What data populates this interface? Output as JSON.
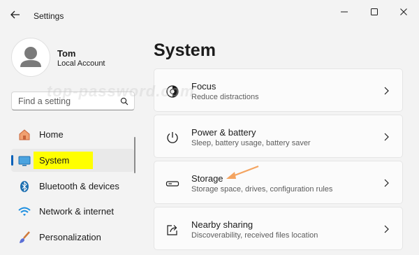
{
  "app": {
    "title": "Settings"
  },
  "user": {
    "name": "Tom",
    "account_type": "Local Account"
  },
  "search": {
    "placeholder": "Find a setting"
  },
  "sidebar": {
    "items": [
      {
        "label": "Home",
        "icon": "home-icon",
        "active": false
      },
      {
        "label": "System",
        "icon": "system-icon",
        "active": true
      },
      {
        "label": "Bluetooth & devices",
        "icon": "bluetooth-icon",
        "active": false
      },
      {
        "label": "Network & internet",
        "icon": "wifi-icon",
        "active": false
      },
      {
        "label": "Personalization",
        "icon": "brush-icon",
        "active": false
      }
    ]
  },
  "main": {
    "title": "System",
    "cards": [
      {
        "title": "Focus",
        "subtitle": "Reduce distractions",
        "icon": "focus-icon"
      },
      {
        "title": "Power & battery",
        "subtitle": "Sleep, battery usage, battery saver",
        "icon": "power-icon"
      },
      {
        "title": "Storage",
        "subtitle": "Storage space, drives, configuration rules",
        "icon": "storage-icon"
      },
      {
        "title": "Nearby sharing",
        "subtitle": "Discoverability, received files location",
        "icon": "share-icon"
      }
    ]
  },
  "watermark": "top-password.com",
  "colors": {
    "accent": "#005fb8",
    "highlight": "#ffff00",
    "arrow": "#f4a460",
    "background": "#f3f3f3"
  }
}
